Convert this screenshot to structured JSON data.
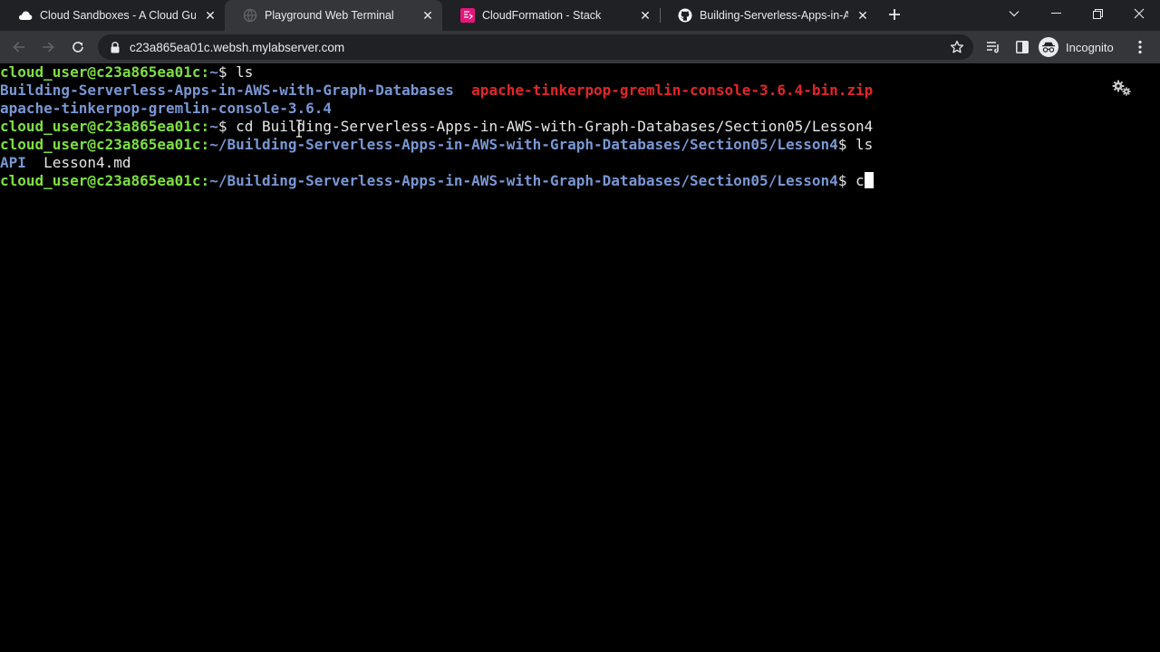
{
  "tabs": [
    {
      "title": "Cloud Sandboxes - A Cloud Guru",
      "icon": "acloudguru-cloud-icon",
      "active": false
    },
    {
      "title": "Playground Web Terminal",
      "icon": "globe-icon",
      "active": true
    },
    {
      "title": "CloudFormation - Stack",
      "icon": "cloudformation-icon",
      "active": false
    },
    {
      "title": "Building-Serverless-Apps-in-AWS",
      "icon": "github-icon",
      "active": false
    }
  ],
  "toolbar": {
    "url": "c23a865ea01c.websh.mylabserver.com",
    "profile_label": "Incognito"
  },
  "colors": {
    "prompt_user": "#7ee040",
    "prompt_path": "#7897d4",
    "directory": "#7897d4",
    "archive": "#e2262a",
    "text": "#e6e6e6",
    "background": "#000000"
  },
  "terminal": {
    "line1": {
      "user": "cloud_user@c23a865ea01c:",
      "path": "~",
      "suffix": "$ ls"
    },
    "line2": {
      "dir": "Building-Serverless-Apps-in-AWS-with-Graph-Databases",
      "gap": "  ",
      "zip": "apache-tinkerpop-gremlin-console-3.6.4-bin.zip"
    },
    "line3": {
      "dir": "apache-tinkerpop-gremlin-console-3.6.4"
    },
    "line4": {
      "user": "cloud_user@c23a865ea01c:",
      "path": "~",
      "suffix": "$ cd Building-Serverless-Apps-in-AWS-with-Graph-Databases/Section05/Lesson4"
    },
    "line5": {
      "user": "cloud_user@c23a865ea01c:",
      "path": "~/Building-Serverless-Apps-in-AWS-with-Graph-Databases/Section05/Lesson4",
      "suffix": "$ ls"
    },
    "line6": {
      "dir": "API",
      "gap": "  ",
      "file": "Lesson4.md"
    },
    "line7": {
      "user": "cloud_user@c23a865ea01c:",
      "path": "~/Building-Serverless-Apps-in-AWS-with-Graph-Databases/Section05/Lesson4",
      "suffix": "$ c"
    }
  }
}
